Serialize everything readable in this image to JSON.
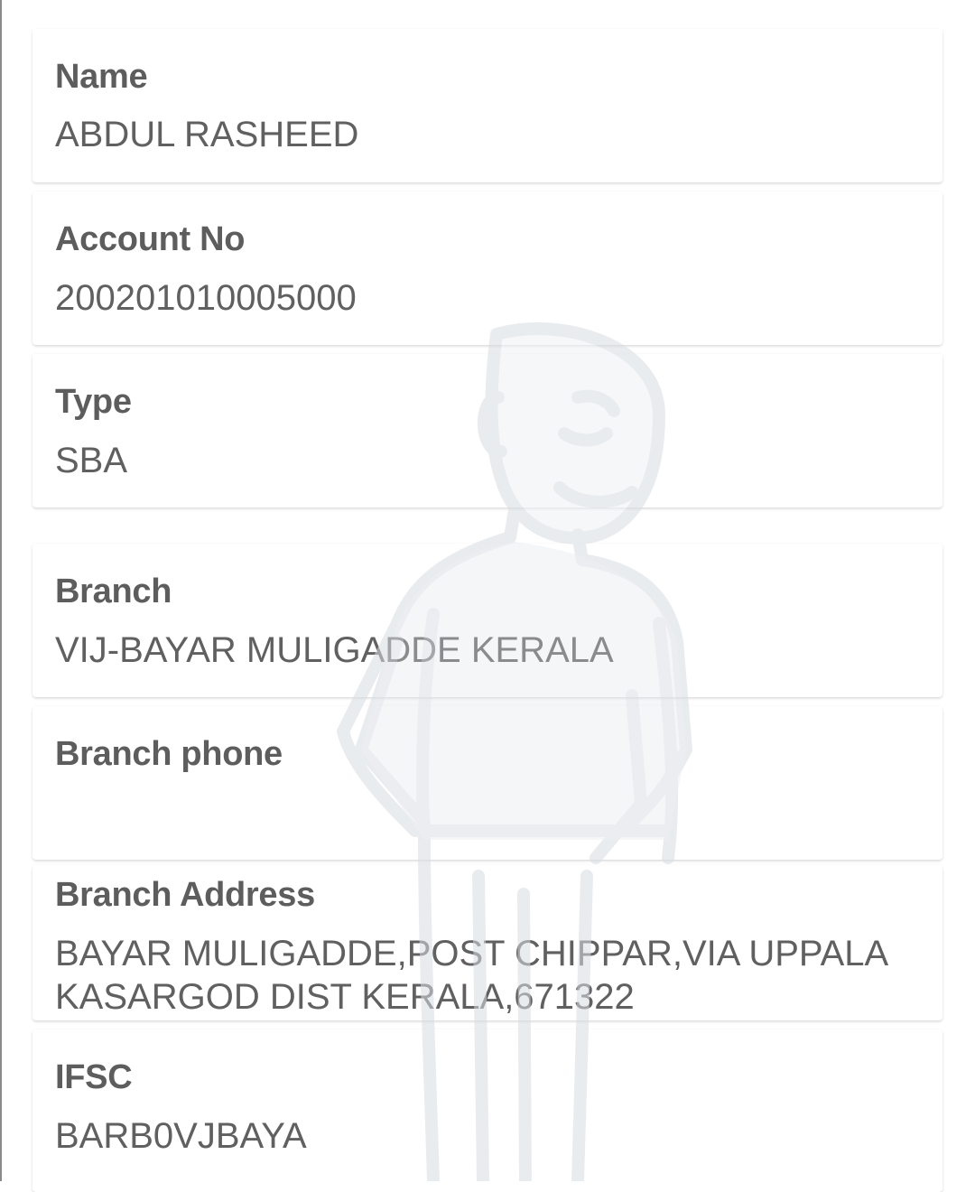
{
  "fields": {
    "name": {
      "label": "Name",
      "value": "ABDUL RASHEED"
    },
    "account_no": {
      "label": "Account No",
      "value": "200201010005000"
    },
    "type": {
      "label": "Type",
      "value": "SBA"
    },
    "branch": {
      "label": "Branch",
      "value": "VIJ-BAYAR MULIGADDE KERALA"
    },
    "branch_phone": {
      "label": "Branch phone",
      "value": ""
    },
    "branch_address": {
      "label": "Branch Address",
      "lines": [
        "BAYAR MULIGADDE,POST CHIPPAR,VIA UPPALA",
        "KASARGOD DIST KERALA,671322"
      ]
    },
    "ifsc": {
      "label": "IFSC",
      "value": "BARB0VJBAYA"
    }
  },
  "watermark": {
    "icon": "mascot-man-icon",
    "color": "#e3e6e9"
  }
}
